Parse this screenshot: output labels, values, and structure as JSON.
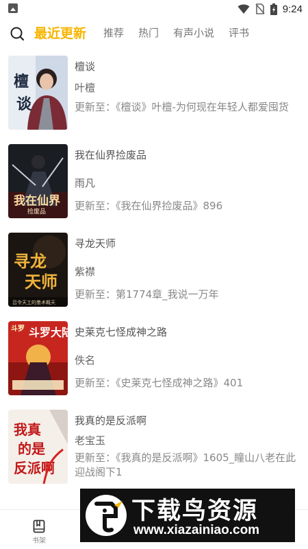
{
  "status_bar": {
    "time": "9:24"
  },
  "nav": {
    "tabs": [
      {
        "label": "最近更新"
      },
      {
        "label": "推荐"
      },
      {
        "label": "热门"
      },
      {
        "label": "有声小说"
      },
      {
        "label": "评书"
      }
    ],
    "active_tab": "最近更新",
    "accent_color": "#f7b500"
  },
  "books": [
    {
      "title": "檀谈",
      "author": "叶檀",
      "update": "更新至：《檀谈》叶檀-为何现在年轻人都爱囤货"
    },
    {
      "title": "我在仙界捡废品",
      "author": "雨凡",
      "update": "更新至：《我在仙界捡废品》896"
    },
    {
      "title": "寻龙天师",
      "author": "紫襟",
      "update": "更新至：第1774章_我说一万年"
    },
    {
      "title": "史莱克七怪成神之路",
      "author": "佚名",
      "update": "更新至：《史莱克七怪成神之路》401"
    },
    {
      "title": "我真的是反派啊",
      "author": "老宝玉",
      "update": "更新至：《我真的是反派啊》1605_瞳山八老在此迎战阁下1"
    }
  ],
  "bottom_nav": [
    {
      "label": "书架"
    }
  ],
  "watermark": {
    "text": "下载鸟资源",
    "url": "www.xiazainiao.com"
  }
}
